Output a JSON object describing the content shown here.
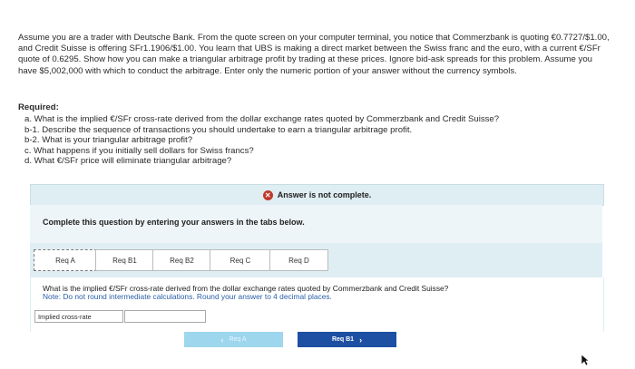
{
  "problem_text": "Assume you are a trader with Deutsche Bank. From the quote screen on your computer terminal, you notice that Commerzbank is quoting €0.7727/$1.00, and Credit Suisse is offering SFr1.1906/$1.00. You learn that UBS is making a direct market between the Swiss franc and the euro, with a current €/SFr quote of 0.6295. Show how you can make a triangular arbitrage profit by trading at these prices. Ignore bid-ask spreads for this problem. Assume you have $5,002,000 with which to conduct the arbitrage. Enter only the numeric portion of your answer without the currency symbols.",
  "required_title": "Required:",
  "requirements": [
    "a. What is the implied €/SFr cross-rate derived from the dollar exchange rates quoted by Commerzbank and Credit Suisse?",
    "b-1. Describe the sequence of transactions you should undertake to earn a triangular arbitrage profit.",
    "b-2. What is your triangular arbitrage profit?",
    "c. What happens if you initially sell dollars for Swiss francs?",
    "d. What €/SFr price will eliminate triangular arbitrage?"
  ],
  "status": {
    "text": "Answer is not complete.",
    "icon": "x-circle-icon",
    "color": "#c0392b"
  },
  "instructions": "Complete this question by entering your answers in the tabs below.",
  "tabs": [
    {
      "label": "Req A",
      "active": true
    },
    {
      "label": "Req B1",
      "active": false
    },
    {
      "label": "Req B2",
      "active": false
    },
    {
      "label": "Req C",
      "active": false
    },
    {
      "label": "Req D",
      "active": false
    }
  ],
  "question": "What is the implied €/SFr cross-rate derived from the dollar exchange rates quoted by Commerzbank and Credit Suisse?",
  "note": "Note: Do not round intermediate calculations. Round your answer to 4 decimal places.",
  "answer_field": {
    "label": "Implied cross-rate",
    "value": ""
  },
  "nav": {
    "prev_label": "Req A",
    "next_label": "Req B1"
  },
  "colors": {
    "accent": "#1d4fa3",
    "panel": "#dfeef3",
    "note": "#2a5fa8"
  }
}
